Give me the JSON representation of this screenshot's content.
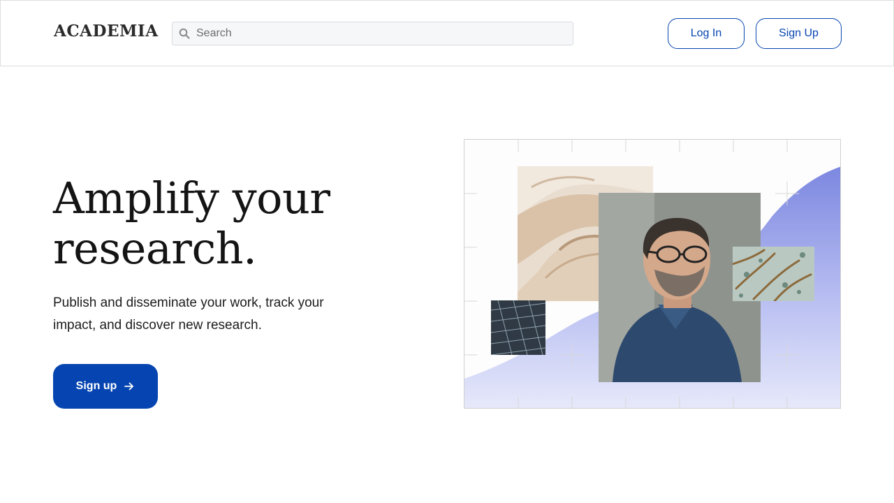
{
  "header": {
    "logo": "ACADEMIA",
    "search": {
      "placeholder": "Search",
      "value": ""
    },
    "login_label": "Log In",
    "signup_label": "Sign Up"
  },
  "hero": {
    "title_line1": "Amplify your",
    "title_line2": "research.",
    "subtitle": "Publish and disseminate your work, track your impact, and discover new research.",
    "cta_label": "Sign up"
  },
  "illustration": {
    "images": [
      "sculpture-photo",
      "solar-panel-photo",
      "researcher-portrait-photo",
      "microscopy-photo"
    ]
  },
  "colors": {
    "brand_blue": "#0645b1",
    "gradient_start": "#7c87e0",
    "gradient_end": "#e7e9fa"
  },
  "icons": {
    "search": "search-icon",
    "arrow": "arrow-right-icon"
  }
}
